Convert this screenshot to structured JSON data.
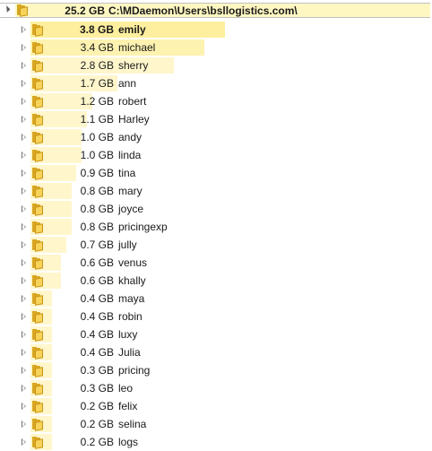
{
  "root": {
    "size": "25.2 GB",
    "path": "C:\\MDaemon\\Users\\bsllogistics.com\\"
  },
  "items": [
    {
      "size": "3.8 GB",
      "name": "emily",
      "fraction": 1.0
    },
    {
      "size": "3.4 GB",
      "name": "michael",
      "fraction": 0.895
    },
    {
      "size": "2.8 GB",
      "name": "sherry",
      "fraction": 0.737
    },
    {
      "size": "1.7 GB",
      "name": "ann",
      "fraction": 0.447
    },
    {
      "size": "1.2 GB",
      "name": "robert",
      "fraction": 0.316
    },
    {
      "size": "1.1 GB",
      "name": "Harley",
      "fraction": 0.289
    },
    {
      "size": "1.0 GB",
      "name": "andy",
      "fraction": 0.263
    },
    {
      "size": "1.0 GB",
      "name": "linda",
      "fraction": 0.263
    },
    {
      "size": "0.9 GB",
      "name": "tina",
      "fraction": 0.237
    },
    {
      "size": "0.8 GB",
      "name": "mary",
      "fraction": 0.211
    },
    {
      "size": "0.8 GB",
      "name": "joyce",
      "fraction": 0.211
    },
    {
      "size": "0.8 GB",
      "name": "pricingexp",
      "fraction": 0.211
    },
    {
      "size": "0.7 GB",
      "name": "jully",
      "fraction": 0.184
    },
    {
      "size": "0.6 GB",
      "name": "venus",
      "fraction": 0.158
    },
    {
      "size": "0.6 GB",
      "name": "khally",
      "fraction": 0.158
    },
    {
      "size": "0.4 GB",
      "name": "maya",
      "fraction": 0.105
    },
    {
      "size": "0.4 GB",
      "name": "robin",
      "fraction": 0.105
    },
    {
      "size": "0.4 GB",
      "name": "luxy",
      "fraction": 0.105
    },
    {
      "size": "0.4 GB",
      "name": "Julia",
      "fraction": 0.105
    },
    {
      "size": "0.3 GB",
      "name": "pricing",
      "fraction": 0.079
    },
    {
      "size": "0.3 GB",
      "name": "leo",
      "fraction": 0.079
    },
    {
      "size": "0.2 GB",
      "name": "felix",
      "fraction": 0.053
    },
    {
      "size": "0.2 GB",
      "name": "selina",
      "fraction": 0.053
    },
    {
      "size": "0.2 GB",
      "name": "logs",
      "fraction": 0.053
    }
  ],
  "colors": {
    "bar": "#fff6cc",
    "bar_top": "#fdef9e",
    "folder": "#f7d35a"
  },
  "icons": {
    "folder": "folder-icon",
    "expander": "expand-arrow-icon",
    "collapse": "collapse-arrow-icon"
  }
}
